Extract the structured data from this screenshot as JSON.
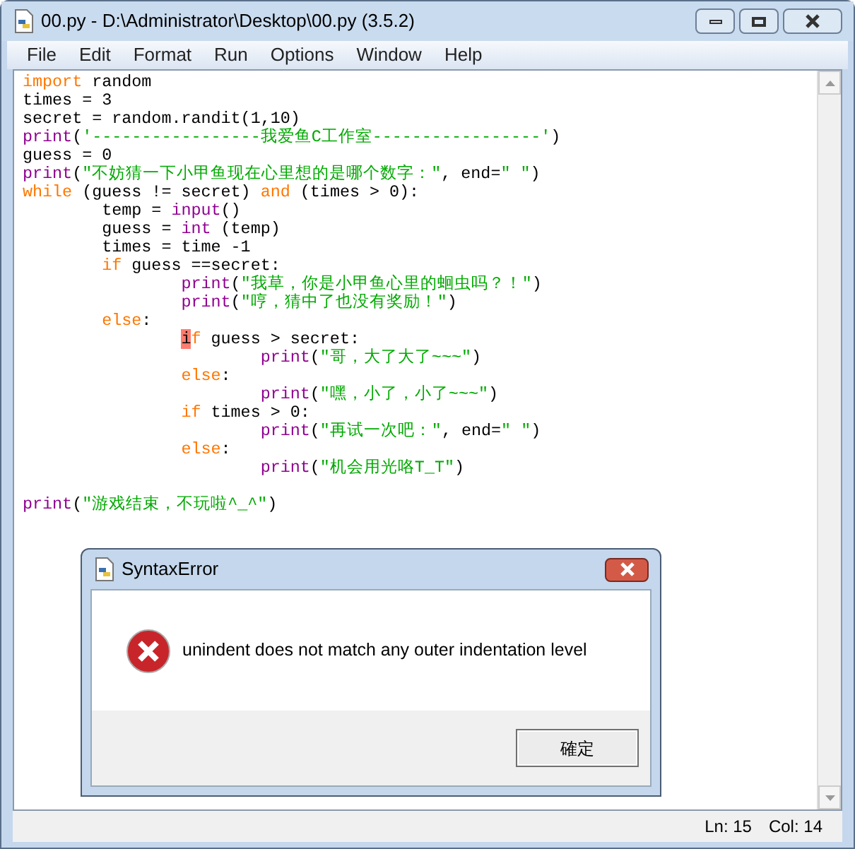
{
  "window": {
    "title": "00.py - D:\\Administrator\\Desktop\\00.py (3.5.2)"
  },
  "menu": [
    "File",
    "Edit",
    "Format",
    "Run",
    "Options",
    "Window",
    "Help"
  ],
  "code_lines": [
    [
      {
        "kind": "keyword",
        "text": "import"
      },
      {
        "kind": "plain",
        "text": " random"
      }
    ],
    [
      {
        "kind": "plain",
        "text": "times = 3"
      }
    ],
    [
      {
        "kind": "plain",
        "text": "secret = random.randit(1,10)"
      }
    ],
    [
      {
        "kind": "builtin",
        "text": "print"
      },
      {
        "kind": "plain",
        "text": "("
      },
      {
        "kind": "string",
        "text": "'-----------------我爱鱼C工作室-----------------'"
      },
      {
        "kind": "plain",
        "text": ")"
      }
    ],
    [
      {
        "kind": "plain",
        "text": "guess = 0"
      }
    ],
    [
      {
        "kind": "builtin",
        "text": "print"
      },
      {
        "kind": "plain",
        "text": "("
      },
      {
        "kind": "string",
        "text": "\"不妨猜一下小甲鱼现在心里想的是哪个数字：\""
      },
      {
        "kind": "plain",
        "text": ", end="
      },
      {
        "kind": "string",
        "text": "\" \""
      },
      {
        "kind": "plain",
        "text": ")"
      }
    ],
    [
      {
        "kind": "keyword",
        "text": "while"
      },
      {
        "kind": "plain",
        "text": " (guess != secret) "
      },
      {
        "kind": "keyword",
        "text": "and"
      },
      {
        "kind": "plain",
        "text": " (times > 0):"
      }
    ],
    [
      {
        "kind": "plain",
        "text": "        temp = "
      },
      {
        "kind": "builtin",
        "text": "input"
      },
      {
        "kind": "plain",
        "text": "()"
      }
    ],
    [
      {
        "kind": "plain",
        "text": "        guess = "
      },
      {
        "kind": "builtin",
        "text": "int"
      },
      {
        "kind": "plain",
        "text": " (temp)"
      }
    ],
    [
      {
        "kind": "plain",
        "text": "        times = time -1"
      }
    ],
    [
      {
        "kind": "keyword",
        "text": "        if"
      },
      {
        "kind": "plain",
        "text": " guess ==secret:"
      }
    ],
    [
      {
        "kind": "builtin",
        "text": "                print"
      },
      {
        "kind": "plain",
        "text": "("
      },
      {
        "kind": "string",
        "text": "\"我草，你是小甲鱼心里的蛔虫吗？！\""
      },
      {
        "kind": "plain",
        "text": ")"
      }
    ],
    [
      {
        "kind": "builtin",
        "text": "                print"
      },
      {
        "kind": "plain",
        "text": "("
      },
      {
        "kind": "string",
        "text": "\"哼，猜中了也没有奖励！\""
      },
      {
        "kind": "plain",
        "text": ")"
      }
    ],
    [
      {
        "kind": "keyword",
        "text": "        else"
      },
      {
        "kind": "plain",
        "text": ":"
      }
    ],
    [
      {
        "kind": "caret",
        "text": "                i"
      },
      {
        "kind": "keyword",
        "text": "f"
      },
      {
        "kind": "plain",
        "text": " guess > secret:"
      }
    ],
    [
      {
        "kind": "builtin",
        "text": "                        print"
      },
      {
        "kind": "plain",
        "text": "("
      },
      {
        "kind": "string",
        "text": "\"哥，大了大了~~~\""
      },
      {
        "kind": "plain",
        "text": ")"
      }
    ],
    [
      {
        "kind": "keyword",
        "text": "                else"
      },
      {
        "kind": "plain",
        "text": ":"
      }
    ],
    [
      {
        "kind": "builtin",
        "text": "                        print"
      },
      {
        "kind": "plain",
        "text": "("
      },
      {
        "kind": "string",
        "text": "\"嘿，小了，小了~~~\""
      },
      {
        "kind": "plain",
        "text": ")"
      }
    ],
    [
      {
        "kind": "keyword",
        "text": "                if"
      },
      {
        "kind": "plain",
        "text": " times > 0:"
      }
    ],
    [
      {
        "kind": "builtin",
        "text": "                        print"
      },
      {
        "kind": "plain",
        "text": "("
      },
      {
        "kind": "string",
        "text": "\"再试一次吧：\""
      },
      {
        "kind": "plain",
        "text": ", end="
      },
      {
        "kind": "string",
        "text": "\" \""
      },
      {
        "kind": "plain",
        "text": ")"
      }
    ],
    [
      {
        "kind": "keyword",
        "text": "                else"
      },
      {
        "kind": "plain",
        "text": ":"
      }
    ],
    [
      {
        "kind": "builtin",
        "text": "                        print"
      },
      {
        "kind": "plain",
        "text": "("
      },
      {
        "kind": "string",
        "text": "\"机会用光咯T_T\""
      },
      {
        "kind": "plain",
        "text": ")"
      }
    ],
    [
      {
        "kind": "blank"
      }
    ],
    [
      {
        "kind": "builtin",
        "text": "print"
      },
      {
        "kind": "plain",
        "text": "("
      },
      {
        "kind": "string",
        "text": "\"游戏结束，不玩啦^_^\""
      },
      {
        "kind": "plain",
        "text": ")"
      }
    ]
  ],
  "dialog": {
    "title": "SyntaxError",
    "message": "unindent does not match any outer indentation level",
    "button": "確定"
  },
  "status_bar": {
    "line": "Ln: 15",
    "column": "Col: 14"
  }
}
